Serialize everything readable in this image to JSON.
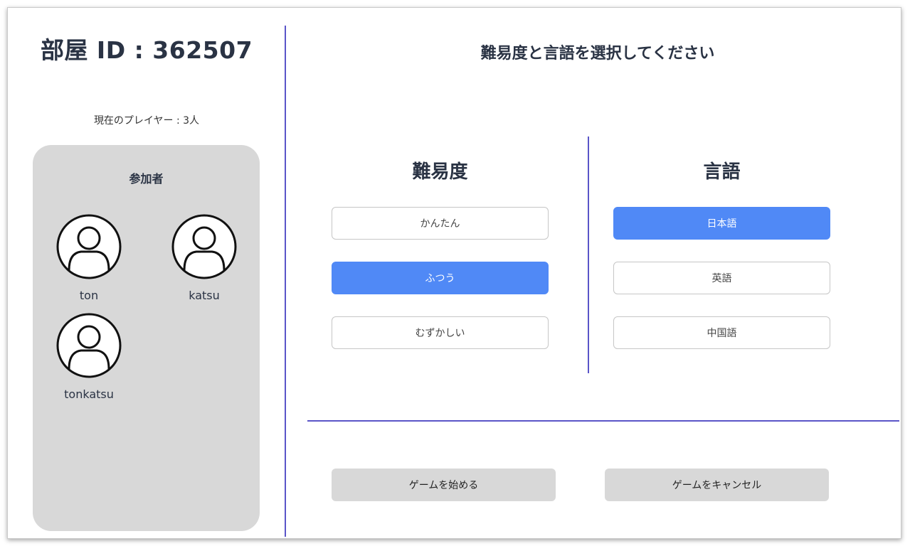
{
  "room": {
    "id_label": "部屋 ID : 362507"
  },
  "players": {
    "count_text": "現在のプレイヤー : 3人",
    "title": "参加者",
    "list": [
      {
        "name": "ton",
        "icon": "user-avatar-icon"
      },
      {
        "name": "katsu",
        "icon": "user-avatar-icon"
      },
      {
        "name": "tonkatsu",
        "icon": "user-avatar-icon"
      }
    ]
  },
  "main": {
    "title": "難易度と言語を選択してください"
  },
  "difficulty": {
    "heading": "難易度",
    "options": [
      "かんたん",
      "ふつう",
      "むずかしい"
    ],
    "selected": "ふつう"
  },
  "language": {
    "heading": "言語",
    "options": [
      "日本語",
      "英語",
      "中国語"
    ],
    "selected": "日本語"
  },
  "actions": {
    "start_label": "ゲームを始める",
    "cancel_label": "ゲームをキャンセル"
  },
  "colors": {
    "accent": "#5089f6",
    "divider": "#5a55c8",
    "panel": "#d8d8d8",
    "text": "#2a3344"
  }
}
